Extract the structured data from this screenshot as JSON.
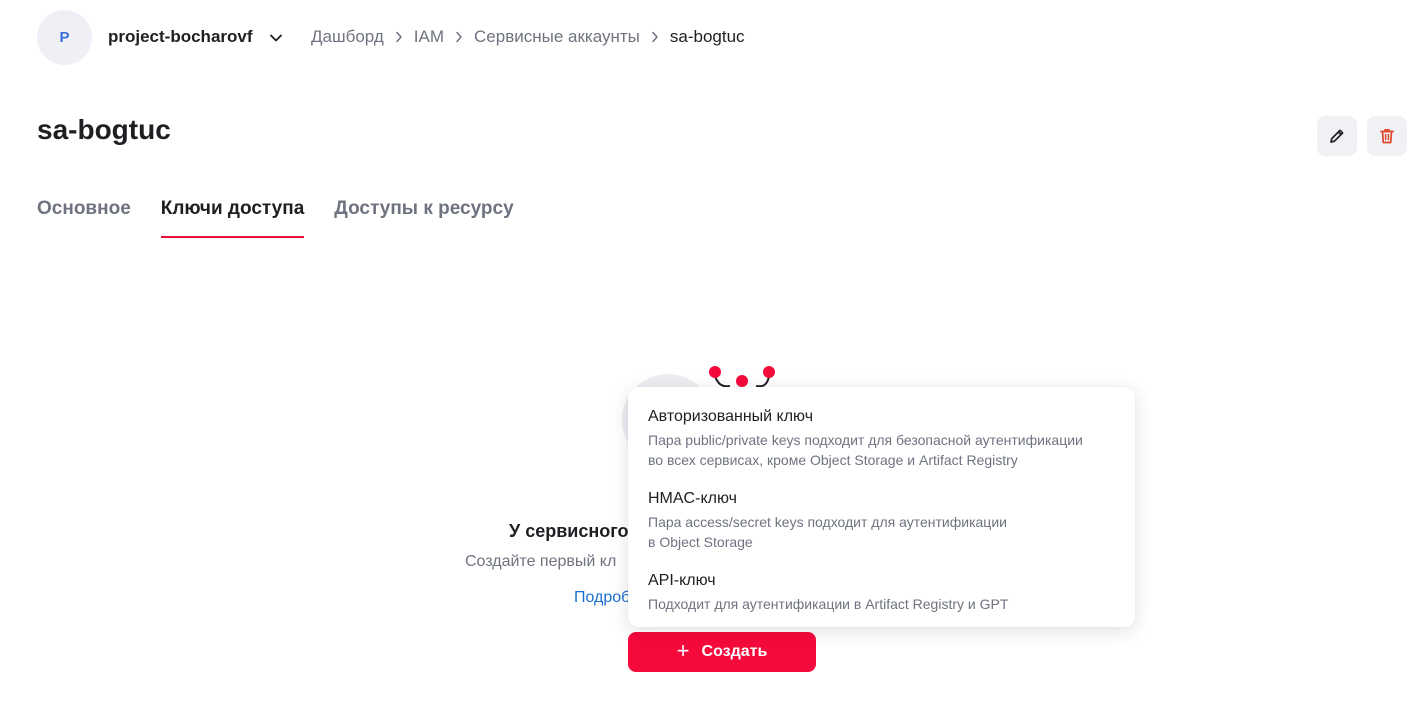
{
  "header": {
    "avatar_letter": "P",
    "project_name": "project-bocharovf",
    "breadcrumb": [
      "Дашборд",
      "IAM",
      "Сервисные аккаунты",
      "sa-bogtuc"
    ]
  },
  "page": {
    "title": "sa-bogtuc"
  },
  "tabs": [
    {
      "label": "Основное",
      "active": false
    },
    {
      "label": "Ключи доступа",
      "active": true
    },
    {
      "label": "Доступы к ресурсу",
      "active": false
    }
  ],
  "empty_state": {
    "title_visible": "У сервисного",
    "description_visible": "Создайте первый кл",
    "link_visible": "Подроб"
  },
  "create_button": {
    "label": "Создать"
  },
  "dropdown": {
    "items": [
      {
        "title": "Авторизованный ключ",
        "description": "Пара public/private keys подходит для безопасной аутентификации\nво всех сервисах, кроме Object Storage и Artifact Registry"
      },
      {
        "title": "HMAC-ключ",
        "description": "Пара access/secret keys подходит для аутентификации\nв Object Storage"
      },
      {
        "title": "API-ключ",
        "description": "Подходит для аутентификации в Artifact Registry и GPT"
      }
    ]
  },
  "colors": {
    "accent": "#f50a3c",
    "link": "#1a6fd1",
    "delete_icon": "#e0462b"
  }
}
